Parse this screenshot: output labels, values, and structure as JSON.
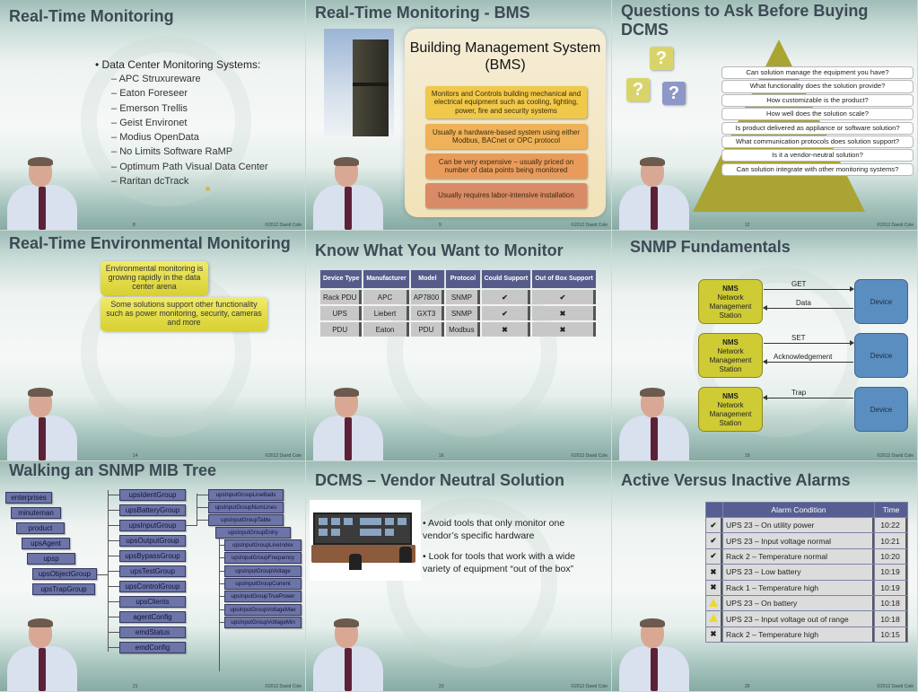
{
  "footer_copyright": "©2012 David Cole",
  "slides": [
    {
      "title": "Real-Time Monitoring",
      "page": "8",
      "bullet": "Data Center Monitoring Systems:",
      "items": [
        "APC Struxureware",
        "Eaton Foreseer",
        "Emerson Trellis",
        "Geist Environet",
        "Modius OpenData",
        "No Limits Software RaMP",
        "Optimum Path Visual Data Center",
        "Raritan dcTrack"
      ]
    },
    {
      "title": "Real-Time Monitoring - BMS",
      "page": "9",
      "panel_title": "Building Management System (BMS)",
      "boxes": [
        {
          "text": "Monitors and Controls building mechanical and electrical equipment such as cooling, lighting, power, fire and security systems",
          "color": "#f1c94a"
        },
        {
          "text": "Usually a hardware-based system using either Modbus, BACnet or OPC protocol",
          "color": "#efb258"
        },
        {
          "text": "Can be very expensive – usually priced on number of data points being monitored",
          "color": "#e99b5c"
        },
        {
          "text": "Usually requires labor-intensive installation",
          "color": "#d98a66"
        }
      ]
    },
    {
      "title": "Questions to Ask Before Buying DCMS",
      "page": "12",
      "question_mark": "?",
      "questions": [
        "Can solution manage the equipment you have?",
        "What functionality does the solution provide?",
        "How customizable is the product?",
        "How well does the solution scale?",
        "Is product delivered as appliance or software solution?",
        "What communication protocols does solution support?",
        "Is it a vendor-neutral solution?",
        "Can solution integrate with other monitoring systems?"
      ]
    },
    {
      "title": "Real-Time Environmental Monitoring",
      "page": "14",
      "boxes": [
        "Environmental monitoring is growing rapidly in the data center arena",
        "Some solutions support other functionality such as power monitoring, security, cameras and more"
      ]
    },
    {
      "title": "Know What You Want to Monitor",
      "page": "16",
      "columns": [
        "Device Type",
        "Manufacturer",
        "Model",
        "Protocol",
        "Could Support",
        "Out of Box Support"
      ],
      "rows": [
        {
          "device": "Rack PDU",
          "manufacturer": "APC",
          "model": "AP7800",
          "protocol": "SNMP",
          "could": "✔",
          "oob": "✔",
          "could_ok": true,
          "oob_ok": true
        },
        {
          "device": "UPS",
          "manufacturer": "Liebert",
          "model": "GXT3",
          "protocol": "SNMP",
          "could": "✔",
          "oob": "✖",
          "could_ok": true,
          "oob_ok": false
        },
        {
          "device": "PDU",
          "manufacturer": "Eaton",
          "model": "PDU",
          "protocol": "Modbus",
          "could": "✖",
          "oob": "✖",
          "could_ok": false,
          "oob_ok": false
        }
      ]
    },
    {
      "title": "SNMP Fundamentals",
      "page": "19",
      "nms_abbr": "NMS",
      "nms_label": "Network Management Station",
      "device_label": "Device",
      "flows": [
        {
          "request": "GET",
          "response": "Data"
        },
        {
          "request": "SET",
          "response": "Acknowledgement"
        },
        {
          "request": "",
          "response": "Trap"
        }
      ]
    },
    {
      "title": "Walking an SNMP MIB Tree",
      "page": "21",
      "chain": [
        "enterprises",
        "minuteman",
        "product",
        "upsAgent",
        "upsp",
        "upsObjectGroup",
        "upsTrapGroup"
      ],
      "groups": [
        "upsIdentGroup",
        "upsBatteryGroup",
        "upsInputGroup",
        "upsOutputGroup",
        "upsBypassGroup",
        "upsTestGroup",
        "upsControlGroup",
        "upsClients",
        "agentConfig",
        "emdStatus",
        "emdConfig"
      ],
      "input_children": [
        "upsInputGroupLineBads",
        "upsInputGroupNumLines",
        "upsInputGroupTable",
        "upsInputGroupEntry"
      ],
      "entry_children": [
        "upsInputGroupLineIndex",
        "upsInputGroupFrequency",
        "upsInputGroupVoltage",
        "upsInputGroupCurrent",
        "upsInputGroupTruePower",
        "upsInputGroupVoltageMax",
        "upsInputGroupVoltageMin"
      ]
    },
    {
      "title": "DCMS – Vendor Neutral Solution",
      "page": "23",
      "bullets": [
        "Avoid tools that only monitor one vendor’s specific hardware",
        "Look for tools that work with a wide variety of equipment “out of the box”"
      ]
    },
    {
      "title": "Active Versus Inactive Alarms",
      "page": "26",
      "columns": [
        "",
        "Alarm Condition",
        "Time"
      ],
      "alarms": [
        {
          "status": "cleared",
          "condition": "UPS 23 – On utility power",
          "time": "10:22"
        },
        {
          "status": "cleared",
          "condition": "UPS 23 – Input voltage normal",
          "time": "10:21"
        },
        {
          "status": "cleared",
          "condition": "Rack 2 – Temperature normal",
          "time": "10:20"
        },
        {
          "status": "critical",
          "condition": "UPS 23 – Low battery",
          "time": "10:19"
        },
        {
          "status": "critical",
          "condition": "Rack 1 – Temperature high",
          "time": "10:19"
        },
        {
          "status": "warning",
          "condition": "UPS 23 – On battery",
          "time": "10:18"
        },
        {
          "status": "warning",
          "condition": "UPS 23 – Input voltage out of range",
          "time": "10:18"
        },
        {
          "status": "critical",
          "condition": "Rack 2 – Temperature high",
          "time": "10:15"
        }
      ],
      "status_icons": {
        "cleared": "✔",
        "critical": "✖",
        "warning": "▲"
      }
    }
  ]
}
